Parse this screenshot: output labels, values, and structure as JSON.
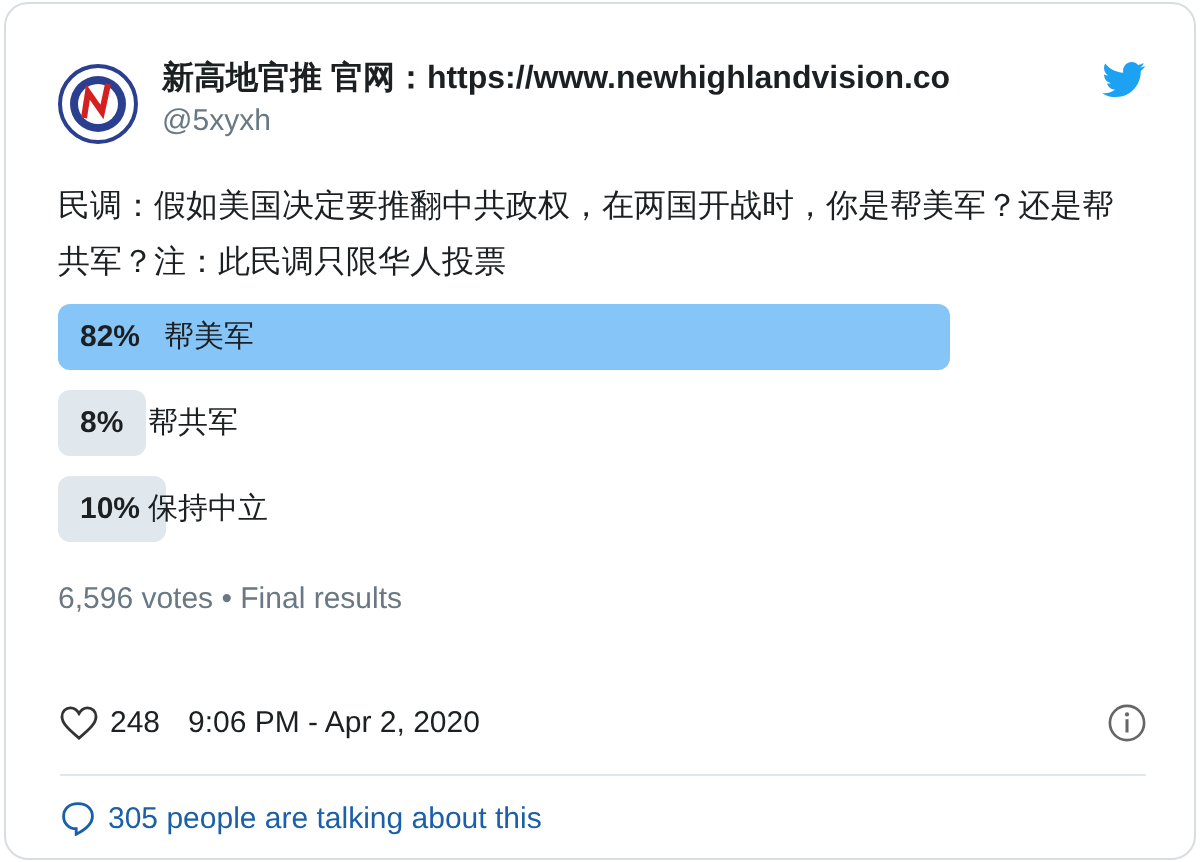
{
  "author": {
    "name": "新高地官推 官网：https://www.newhighlandvision.co",
    "handle": "@5xyxh"
  },
  "text": "民调：假如美国决定要推翻中共政权，在两国开战时，你是帮美军？还是帮共军？注：此民调只限华人投票",
  "poll": {
    "options": [
      {
        "percent": "82%",
        "label": "帮美军",
        "winner": true
      },
      {
        "percent": "8%",
        "label": "帮共军",
        "winner": false
      },
      {
        "percent": "10%",
        "label": "保持中立",
        "winner": false
      }
    ],
    "summary": "6,596 votes • Final results"
  },
  "likes": "248",
  "timestamp": "9:06 PM - Apr 2, 2020",
  "conversation": "305 people are talking about this"
}
